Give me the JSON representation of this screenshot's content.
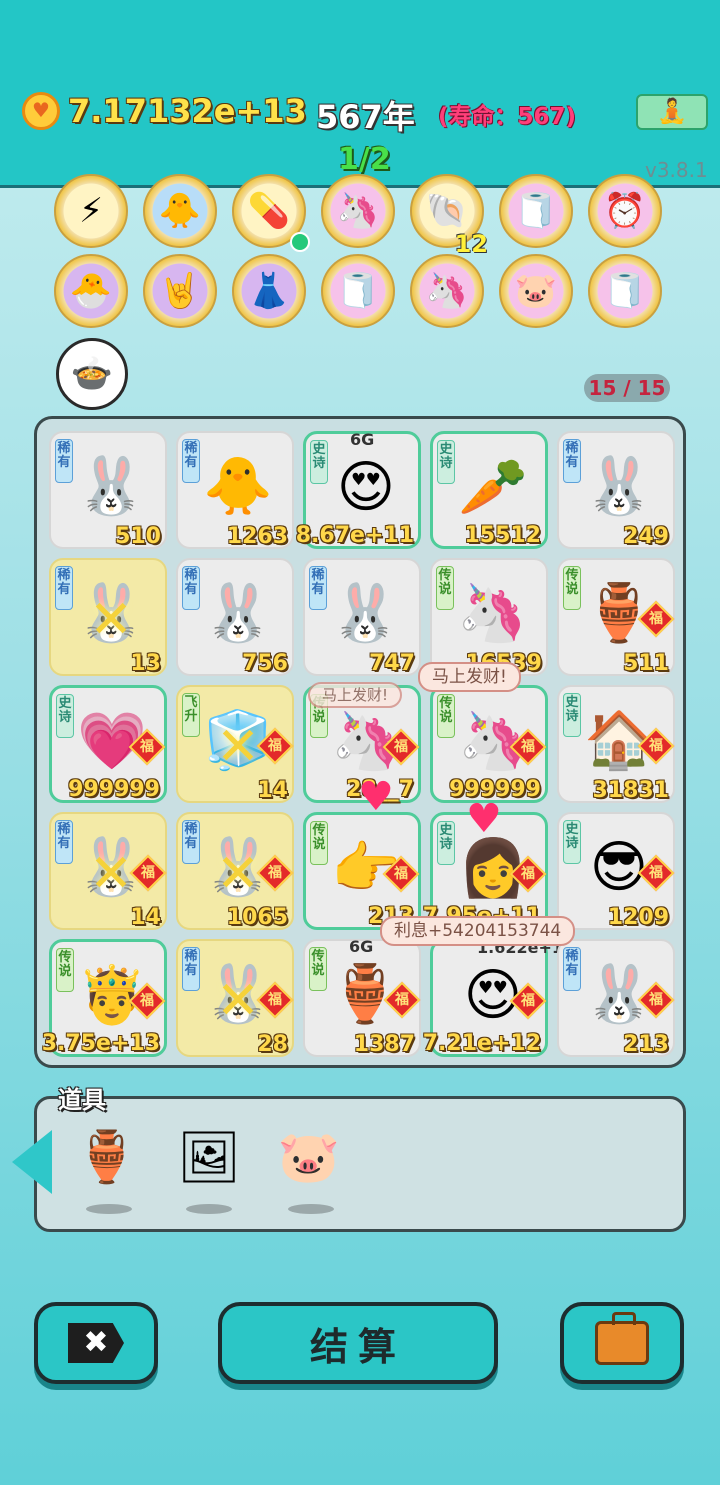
{
  "header": {
    "coin_value": "7.17132e+13",
    "year": "567年",
    "lifespan": "(寿命：567)",
    "progress": "1/2",
    "version": "v3.8.1",
    "meditate_icon": "meditation-icon"
  },
  "buffs_row1": [
    {
      "icon": "lightning-icon",
      "glyph": "⚡",
      "style": "yellow"
    },
    {
      "icon": "chick-syringe-icon",
      "glyph": "🐥",
      "style": "blue"
    },
    {
      "icon": "pill-pack-icon",
      "glyph": "💊",
      "style": "yellow"
    },
    {
      "icon": "unicorn-icon",
      "glyph": "🦄",
      "style": "pink"
    },
    {
      "icon": "shell-icon",
      "glyph": "🐚",
      "style": "yellow",
      "count": "12"
    },
    {
      "icon": "tissue-box-icon",
      "glyph": "🧻",
      "style": "pink"
    },
    {
      "icon": "time-card-icon",
      "glyph": "⏰",
      "style": "pink"
    }
  ],
  "buffs_row2": [
    {
      "icon": "chick-egg-icon",
      "glyph": "🐣",
      "style": "purple"
    },
    {
      "icon": "rock-hand-icon",
      "glyph": "🤘",
      "style": "purple"
    },
    {
      "icon": "skirt-icon",
      "glyph": "👗",
      "style": "purple"
    },
    {
      "icon": "tissue-box-icon",
      "glyph": "🧻",
      "style": "pink"
    },
    {
      "icon": "unicorn-icon",
      "glyph": "🦄",
      "style": "pink"
    },
    {
      "icon": "piggy-bank-icon",
      "glyph": "🐷",
      "style": "pink"
    },
    {
      "icon": "tissue-box-icon",
      "glyph": "🧻",
      "style": "pink"
    }
  ],
  "pot_icon": "duck-pot-icon",
  "slots_counter": "15 / 15",
  "grid": [
    {
      "tag": "稀有",
      "tagtype": "rare",
      "glyph": "🐰",
      "value": "510"
    },
    {
      "tag": "稀有",
      "tagtype": "rare",
      "glyph": "🐥",
      "value": "1263"
    },
    {
      "tag": "史诗",
      "tagtype": "epic",
      "glyph": "😍",
      "value": "8.67e+11",
      "badge": "6G",
      "border": "epic"
    },
    {
      "tag": "史诗",
      "tagtype": "epic",
      "glyph": "🥕",
      "value": "15512",
      "border": "epic"
    },
    {
      "tag": "稀有",
      "tagtype": "rare",
      "glyph": "🐰",
      "value": "249"
    },
    {
      "tag": "稀有",
      "tagtype": "rare",
      "glyph": "🐰",
      "value": "13",
      "gold": true,
      "x": true
    },
    {
      "tag": "稀有",
      "tagtype": "rare",
      "glyph": "🐰",
      "value": "756"
    },
    {
      "tag": "稀有",
      "tagtype": "rare",
      "glyph": "🐰",
      "value": "747"
    },
    {
      "tag": "传说",
      "tagtype": "legend",
      "glyph": "🦄",
      "value": "16539"
    },
    {
      "tag": "传说",
      "tagtype": "legend",
      "glyph": "🏺",
      "value": "511",
      "fu": true
    },
    {
      "tag": "史诗",
      "tagtype": "epic",
      "glyph": "💗",
      "value": "999999",
      "fu": true,
      "border": "epic"
    },
    {
      "tag": "飞升",
      "tagtype": "legend",
      "glyph": "🧊",
      "value": "14",
      "gold": true,
      "x": true,
      "fu": true
    },
    {
      "tag": "传说",
      "tagtype": "legend",
      "glyph": "🦄",
      "value": "28__7",
      "fu": true,
      "border": "legend"
    },
    {
      "tag": "传说",
      "tagtype": "legend",
      "glyph": "🦄",
      "value": "999999",
      "fu": true,
      "border": "legend"
    },
    {
      "tag": "史诗",
      "tagtype": "epic",
      "glyph": "🏠",
      "value": "31831",
      "fu": true
    },
    {
      "tag": "稀有",
      "tagtype": "rare",
      "glyph": "🐰",
      "value": "14",
      "gold": true,
      "x": true,
      "fu": true
    },
    {
      "tag": "稀有",
      "tagtype": "rare",
      "glyph": "🐰",
      "value": "1065",
      "gold": true,
      "x": true,
      "fu": true
    },
    {
      "tag": "传说",
      "tagtype": "legend",
      "glyph": "👉",
      "value": "213",
      "fu": true,
      "border": "legend"
    },
    {
      "tag": "史诗",
      "tagtype": "epic",
      "glyph": "👩",
      "value": "7.95e+11",
      "fu": true,
      "border": "epic"
    },
    {
      "tag": "史诗",
      "tagtype": "epic",
      "glyph": "😎",
      "value": "1209",
      "fu": true
    },
    {
      "tag": "传说",
      "tagtype": "legend",
      "glyph": "🤴",
      "value": "3.75e+13",
      "fu": true,
      "border": "legend"
    },
    {
      "tag": "稀有",
      "tagtype": "rare",
      "glyph": "🐰",
      "value": "28",
      "gold": true,
      "x": true,
      "fu": true
    },
    {
      "tag": "传说",
      "tagtype": "legend",
      "glyph": "🏺",
      "value": "1387",
      "fu": true,
      "badge": "6G"
    },
    {
      "tag": "",
      "tagtype": "",
      "glyph": "😍",
      "value": "7.21e+12",
      "fu": true,
      "badge": "1.622e+12",
      "border": "epic"
    },
    {
      "tag": "稀有",
      "tagtype": "rare",
      "glyph": "🐰",
      "value": "213",
      "fu": true
    }
  ],
  "fu_label": "福",
  "x_glyph": "✕",
  "toasts": {
    "fortune1": "马上发财!",
    "fortune2": "马上发财!",
    "interest": "利息+54204153744"
  },
  "tools": {
    "label": "道具",
    "items": [
      {
        "icon": "jade-vase-icon",
        "glyph": "🏺"
      },
      {
        "icon": "frame-icon",
        "glyph": "🖼"
      },
      {
        "icon": "piggy-bank-icon",
        "glyph": "🐷"
      }
    ]
  },
  "buttons": {
    "close_glyph": "✖",
    "settle": "结算",
    "bag_icon": "briefcase-icon"
  }
}
